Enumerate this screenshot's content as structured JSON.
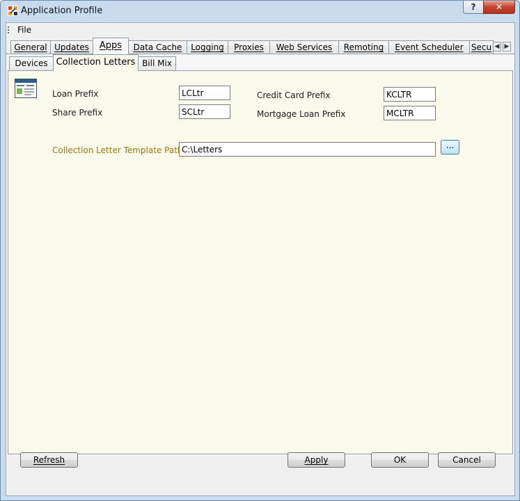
{
  "window": {
    "title": "Application Profile"
  },
  "menu": {
    "file": "File"
  },
  "tabs_top": [
    "General",
    "Updates",
    "Apps",
    "Data Cache",
    "Logging",
    "Proxies",
    "Web Services",
    "Remoting",
    "Event Scheduler",
    "Secu"
  ],
  "tabs_top_active": "Apps",
  "tabs_sub": [
    "Devices",
    "Collection Letters",
    "Bill Mix"
  ],
  "tabs_sub_active": "Collection Letters",
  "form": {
    "loan_prefix_label": "Loan Prefix",
    "loan_prefix_value": "LCLtr",
    "share_prefix_label": "Share Prefix",
    "share_prefix_value": "SCLtr",
    "credit_card_prefix_label": "Credit Card Prefix",
    "credit_card_prefix_value": "KCLTR",
    "mortgage_loan_prefix_label": "Mortgage Loan Prefix",
    "mortgage_loan_prefix_value": "MCLTR",
    "template_path_label": "Collection Letter Template Path",
    "template_path_value": "C:\\Letters",
    "browse_label": "..."
  },
  "buttons": {
    "refresh": "Refresh",
    "apply": "Apply",
    "ok": "OK",
    "cancel": "Cancel"
  },
  "colors": {
    "content_bg": "#fbf8ec",
    "template_label": "#9a7b16",
    "frame": "#c9dcef",
    "close_button": "#c2452f"
  },
  "icons": {
    "app": "app-icon",
    "help": "question-mark-icon",
    "close": "close-icon",
    "tab_scroll_left": "chevron-left-icon",
    "tab_scroll_right": "chevron-right-icon",
    "panel": "collection-letters-icon"
  }
}
